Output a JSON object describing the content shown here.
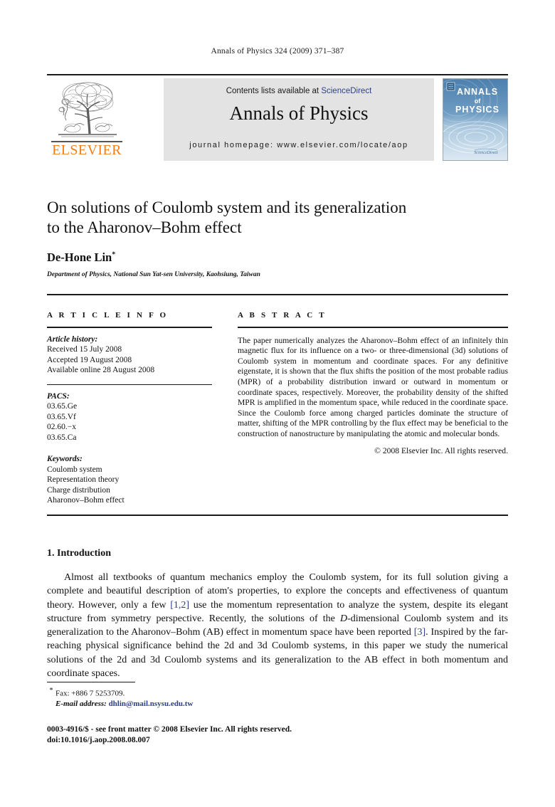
{
  "running_head": "Annals of Physics 324 (2009) 371–387",
  "masthead": {
    "contents_prefix": "Contents lists available at ",
    "sciencedirect": "ScienceDirect",
    "journal_title": "Annals of Physics",
    "homepage": "journal homepage: www.elsevier.com/locate/aop",
    "publisher_wordmark": "ELSEVIER",
    "cover": {
      "line1": "ANNALS",
      "line2": "of",
      "line3": "PHYSICS",
      "footer": "ScienceDirect"
    },
    "colors": {
      "panel_bg": "#e3e3e3",
      "link": "#2b3f8c",
      "elsevier_orange": "#F07F1A",
      "cover_blue": "#4a7eae"
    }
  },
  "article": {
    "title_line1": "On solutions of Coulomb system and its generalization",
    "title_line2": "to the Aharonov–Bohm effect",
    "author": "De-Hone Lin",
    "author_marker": "*",
    "affiliation": "Department of Physics, National Sun Yat-sen University, Kaohsiung, Taiwan"
  },
  "article_info": {
    "heading": "A R T I C L E   I N F O",
    "history_label": "Article history:",
    "history": [
      "Received 15 July 2008",
      "Accepted 19 August 2008",
      "Available online 28 August 2008"
    ],
    "pacs_label": "PACS:",
    "pacs": [
      "03.65.Ge",
      "03.65.Vf",
      "02.60.−x",
      "03.65.Ca"
    ],
    "keywords_label": "Keywords:",
    "keywords": [
      "Coulomb system",
      "Representation theory",
      "Charge distribution",
      "Aharonov–Bohm effect"
    ]
  },
  "abstract": {
    "heading": "A B S T R A C T",
    "text": "The paper numerically analyzes the Aharonov–Bohm effect of an infinitely thin magnetic flux for its influence on a two- or three-dimensional (3d) solutions of Coulomb system in momentum and coordinate spaces. For any definitive eigenstate, it is shown that the flux shifts the position of the most probable radius (MPR) of a probability distribution inward or outward in momentum or coordinate spaces, respectively. Moreover, the probability density of the shifted MPR is amplified in the momentum space, while reduced in the coordinate space. Since the Coulomb force among charged particles dominate the structure of matter, shifting of the MPR controlling by the flux effect may be beneficial to the construction of nanostructure by manipulating the atomic and molecular bonds.",
    "copyright": "© 2008 Elsevier Inc. All rights reserved."
  },
  "introduction": {
    "heading": "1. Introduction",
    "p1_a": "Almost all textbooks of quantum mechanics employ the Coulomb system, for its full solution giving a complete and beautiful description of atom's properties, to explore the concepts and effectiveness of quantum theory. However, only a few ",
    "cite1": "[1,2]",
    "p1_b": " use the momentum representation to analyze the system, despite its elegant structure from symmetry perspective. Recently, the solutions of the ",
    "ital_d": "D",
    "p1_c": "-dimensional Coulomb system and its generalization to the Aharonov–Bohm (AB) effect in momentum space have been reported ",
    "cite2": "[3]",
    "p1_d": ". Inspired by the far-reaching physical significance behind the 2d and 3d Coulomb systems, in this paper we study the numerical solutions of the 2d and 3d Coulomb systems and its generalization to the AB effect in both momentum and coordinate spaces."
  },
  "footnotes": {
    "marker": "*",
    "fax": "Fax: +886 7 5253709.",
    "email_label": "E-mail address:",
    "email": "dhlin@mail.nsysu.edu.tw"
  },
  "imprint": {
    "line1": "0003-4916/$ - see front matter © 2008 Elsevier Inc. All rights reserved.",
    "line2": "doi:10.1016/j.aop.2008.08.007"
  }
}
